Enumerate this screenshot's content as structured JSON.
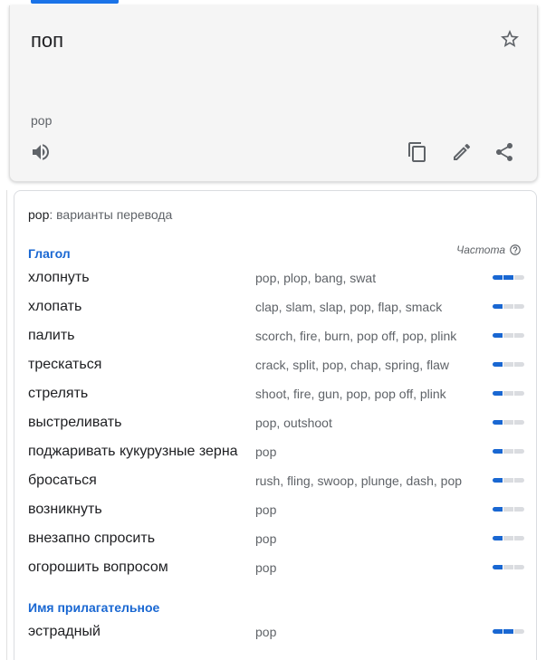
{
  "result": {
    "text": "поп",
    "transliteration": "pop"
  },
  "icons": {
    "star": "star-outline-icon",
    "speaker": "volume-icon",
    "copy": "copy-icon",
    "edit": "pencil-icon",
    "share": "share-icon"
  },
  "dictionary": {
    "word": "pop",
    "title_suffix": ": варианты перевода",
    "frequency_label": "Частота",
    "sections": [
      {
        "pos": "Глагол",
        "entries": [
          {
            "term": "хлопнуть",
            "translations": "pop, plop, bang, swat",
            "frequency": 2
          },
          {
            "term": "хлопать",
            "translations": "clap, slam, slap, pop, flap, smack",
            "frequency": 1
          },
          {
            "term": "палить",
            "translations": "scorch, fire, burn, pop off, pop, plink",
            "frequency": 1
          },
          {
            "term": "трескаться",
            "translations": "crack, split, pop, chap, spring, flaw",
            "frequency": 1
          },
          {
            "term": "стрелять",
            "translations": "shoot, fire, gun, pop, pop off, plink",
            "frequency": 1
          },
          {
            "term": "выстреливать",
            "translations": "pop, outshoot",
            "frequency": 1
          },
          {
            "term": "поджаривать кукурузные зерна",
            "translations": "pop",
            "frequency": 1
          },
          {
            "term": "бросаться",
            "translations": "rush, fling, swoop, plunge, dash, pop",
            "frequency": 1
          },
          {
            "term": "возникнуть",
            "translations": "pop",
            "frequency": 1
          },
          {
            "term": "внезапно спросить",
            "translations": "pop",
            "frequency": 1
          },
          {
            "term": "огорошить вопросом",
            "translations": "pop",
            "frequency": 1
          }
        ]
      },
      {
        "pos": "Имя прилагательное",
        "entries": [
          {
            "term": "эстрадный",
            "translations": "pop",
            "frequency": 2
          }
        ]
      }
    ]
  },
  "colors": {
    "accent": "#1a73e8",
    "pos_label": "#1967d2",
    "freq_on": "#1967d2",
    "freq_off": "#dadce0",
    "card_bg": "#f5f5f5"
  }
}
